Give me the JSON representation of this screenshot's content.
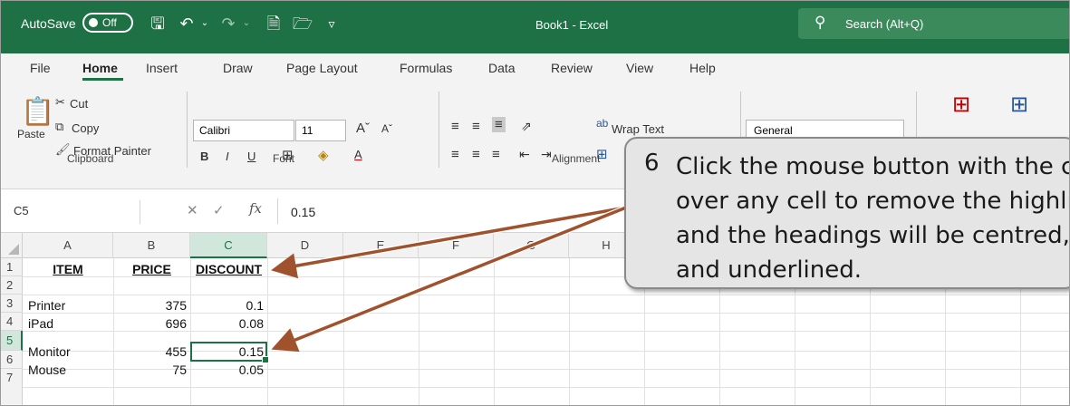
{
  "window": {
    "autosave_label": "AutoSave",
    "autosave_state": "Off",
    "title": "Book1  -  Excel",
    "search_placeholder": "Search (Alt+Q)",
    "accent": "#1e7145"
  },
  "tabs": [
    "File",
    "Home",
    "Insert",
    "Draw",
    "Page Layout",
    "Formulas",
    "Data",
    "Review",
    "View",
    "Help"
  ],
  "ribbon": {
    "clipboard": {
      "paste": "Paste",
      "cut": "Cut",
      "copy": "Copy",
      "format_painter": "Format Painter",
      "group_label": "Clipboard"
    },
    "font": {
      "family": "Calibri",
      "size": "11",
      "group_label": "Font"
    },
    "alignment": {
      "wrap_text": "Wrap Text",
      "group_label": "Alignment"
    },
    "number": {
      "format": "General"
    }
  },
  "formula_bar": {
    "name_box": "C5",
    "fx": "fx",
    "value": "0.15"
  },
  "sheet": {
    "columns": [
      "A",
      "B",
      "C",
      "D",
      "E",
      "F",
      "G",
      "H"
    ],
    "selected_column": "C",
    "rows": [
      "1",
      "2",
      "3",
      "4",
      "5",
      "6",
      "7"
    ],
    "selected_row": "5",
    "headers": {
      "a1": "ITEM",
      "b1": "PRICE",
      "c1": "DISCOUNT"
    },
    "data": [
      {
        "row": "3",
        "item": "Printer",
        "price": "375",
        "discount": "0.1"
      },
      {
        "row": "4",
        "item": "iPad",
        "price": "696",
        "discount": "0.08"
      },
      {
        "row": "5",
        "item": "Monitor",
        "price": "455",
        "discount": "0.15"
      },
      {
        "row": "6",
        "item": "Mouse",
        "price": "75",
        "discount": "0.05"
      }
    ]
  },
  "callout": {
    "number": "6",
    "text": "Click the mouse button with the cursor over any cell to remove the highlight and the headings will be centred, bold and underlined."
  }
}
